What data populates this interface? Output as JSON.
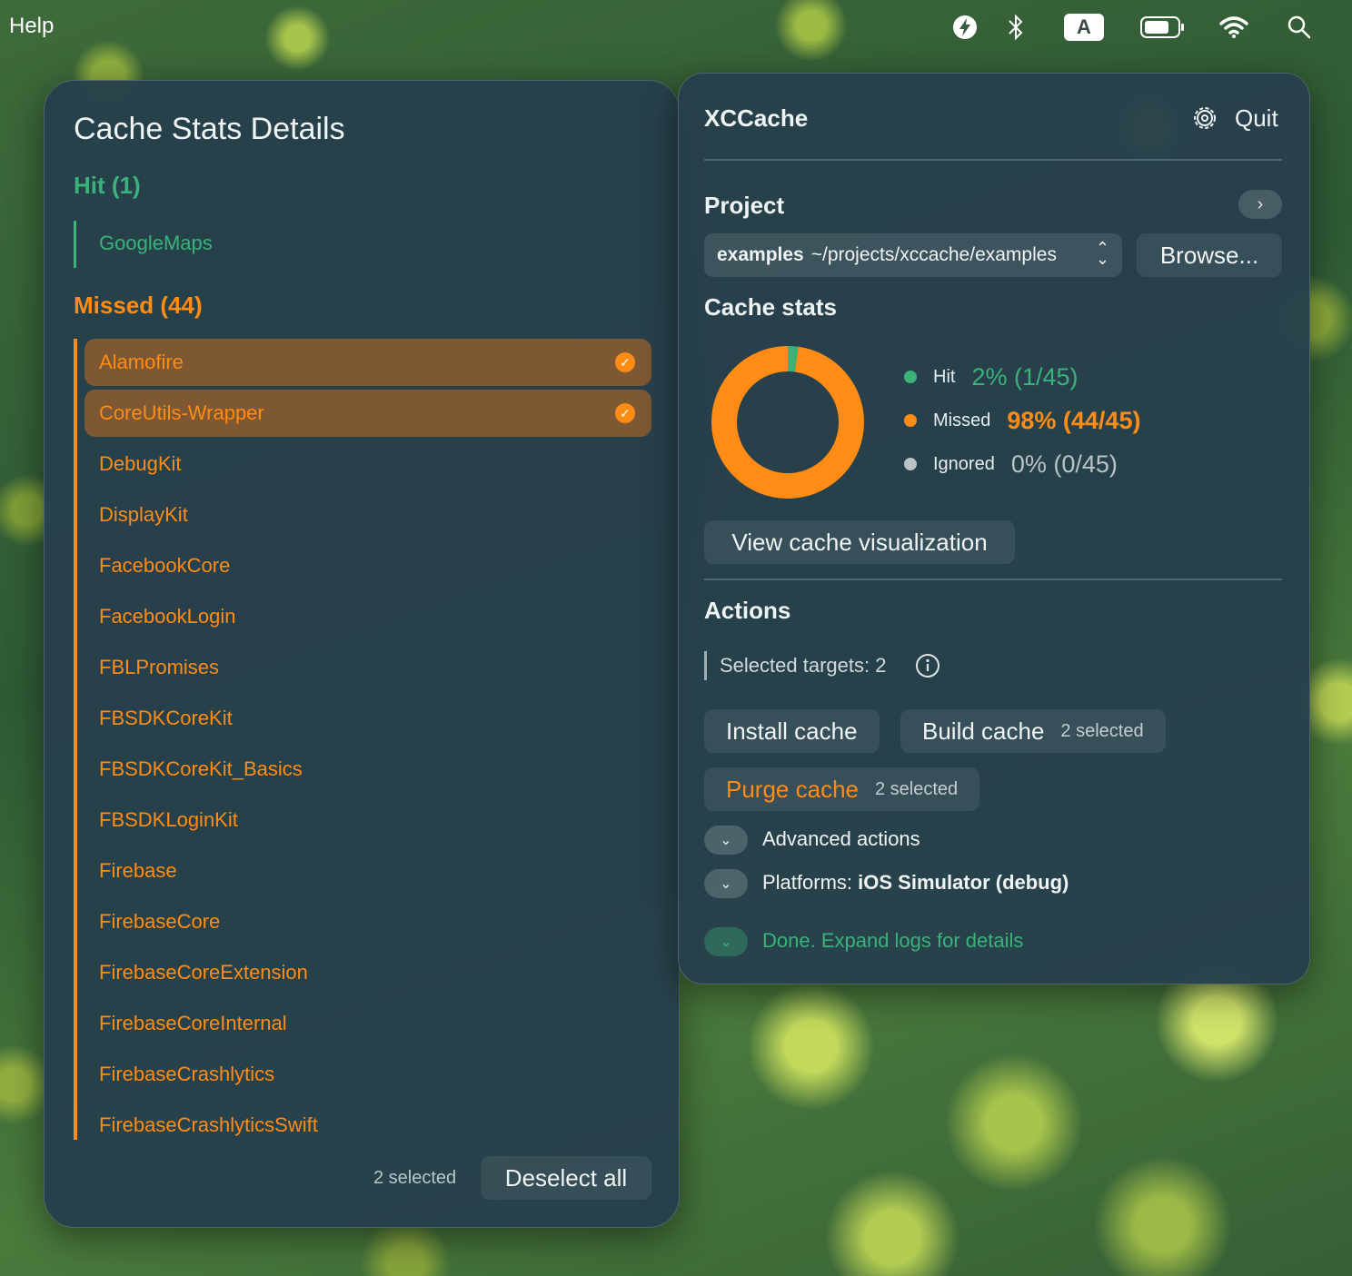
{
  "menubar": {
    "help_label": "Help",
    "keyboard_letter": "A",
    "icons": [
      "lightning-bolt-icon",
      "bluetooth-icon",
      "keyboard-input-icon",
      "battery-icon",
      "wifi-icon",
      "search-icon"
    ]
  },
  "details": {
    "title": "Cache Stats Details",
    "hit_header": "Hit (1)",
    "hit_items": [
      "GoogleMaps"
    ],
    "missed_header": "Missed (44)",
    "missed_items": [
      {
        "label": "Alamofire",
        "selected": true
      },
      {
        "label": "CoreUtils-Wrapper",
        "selected": true
      },
      {
        "label": "DebugKit",
        "selected": false
      },
      {
        "label": "DisplayKit",
        "selected": false
      },
      {
        "label": "FacebookCore",
        "selected": false
      },
      {
        "label": "FacebookLogin",
        "selected": false
      },
      {
        "label": "FBLPromises",
        "selected": false
      },
      {
        "label": "FBSDKCoreKit",
        "selected": false
      },
      {
        "label": "FBSDKCoreKit_Basics",
        "selected": false
      },
      {
        "label": "FBSDKLoginKit",
        "selected": false
      },
      {
        "label": "Firebase",
        "selected": false
      },
      {
        "label": "FirebaseCore",
        "selected": false
      },
      {
        "label": "FirebaseCoreExtension",
        "selected": false
      },
      {
        "label": "FirebaseCoreInternal",
        "selected": false
      },
      {
        "label": "FirebaseCrashlytics",
        "selected": false
      },
      {
        "label": "FirebaseCrashlyticsSwift",
        "selected": false
      }
    ],
    "selected_count": "2 selected",
    "deselect_label": "Deselect all"
  },
  "app": {
    "title": "XCCache",
    "quit_label": "Quit",
    "project_section": "Project",
    "project_name": "examples",
    "project_path": "~/projects/xccache/examples",
    "browse_label": "Browse...",
    "cache_stats_section": "Cache stats",
    "stats": [
      {
        "name": "Hit",
        "value": "2% (1/45)",
        "color": "#3ab27a"
      },
      {
        "name": "Missed",
        "value": "98% (44/45)",
        "color": "#ff8c14"
      },
      {
        "name": "Ignored",
        "value": "0% (0/45)",
        "color": "#b9c3c7"
      }
    ],
    "donut_fractions": {
      "hit": 0.022,
      "missed": 0.978,
      "ignored": 0.0
    },
    "view_viz_label": "View cache visualization",
    "actions_section": "Actions",
    "selected_targets": "Selected targets: 2",
    "install_label": "Install cache",
    "build_label": "Build cache",
    "build_sub": "2 selected",
    "purge_label": "Purge cache",
    "purge_sub": "2 selected",
    "advanced_label": "Advanced actions",
    "platforms_prefix": "Platforms:",
    "platforms_value": "iOS Simulator (debug)",
    "done_label": "Done. Expand logs for details"
  },
  "colors": {
    "accent_hit": "#3ab27a",
    "accent_missed": "#ff8c14",
    "panel_bg": "#26404c"
  }
}
